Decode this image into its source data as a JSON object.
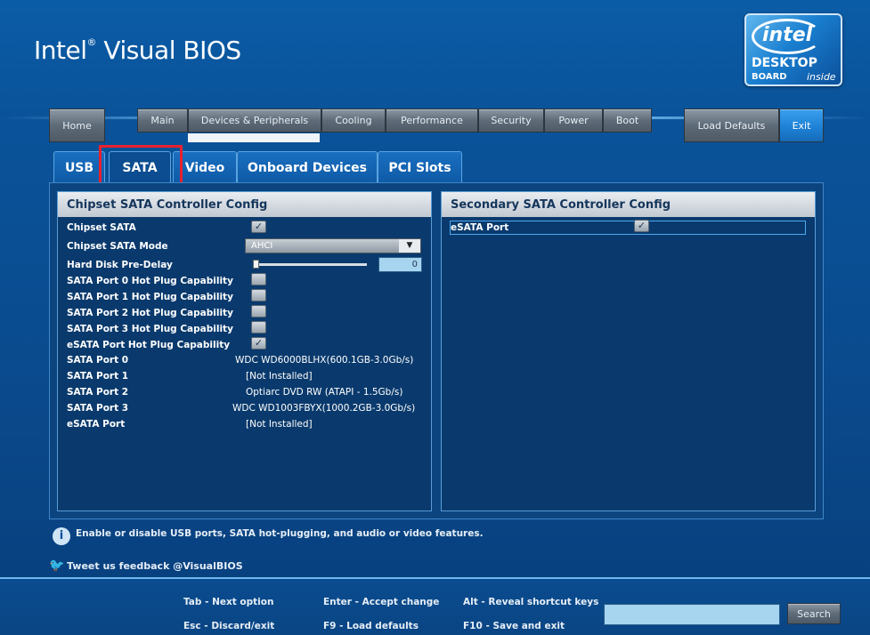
{
  "app": {
    "title": "Intel",
    "title_mark": "®",
    "title_rest": " Visual BIOS"
  },
  "logo": {
    "brand": "intel",
    "line1": "DESKTOP",
    "line2": "BOARD",
    "line3": "inside"
  },
  "nav": {
    "home": "Home",
    "menu": [
      "Main",
      "Devices & Peripherals",
      "Cooling",
      "Performance",
      "Security",
      "Power",
      "Boot"
    ],
    "active_menu": "Devices & Peripherals",
    "load_defaults": "Load Defaults",
    "exit": "Exit"
  },
  "subtabs": [
    "USB",
    "SATA",
    "Video",
    "Onboard Devices",
    "PCI Slots"
  ],
  "active_subtab": "SATA",
  "chipset_panel": {
    "title": "Chipset SATA Controller Config",
    "rows": [
      {
        "label": "Chipset SATA",
        "checked": true
      },
      {
        "label": "Chipset SATA Mode",
        "value": "AHCI"
      },
      {
        "label": "Hard Disk Pre-Delay",
        "value": "0"
      },
      {
        "label": "SATA Port 0 Hot Plug Capability",
        "checked": false
      },
      {
        "label": "SATA Port 1 Hot Plug Capability",
        "checked": false
      },
      {
        "label": "SATA Port 2 Hot Plug Capability",
        "checked": false
      },
      {
        "label": "SATA Port 3 Hot Plug Capability",
        "checked": false
      },
      {
        "label": "eSATA Port Hot Plug Capability",
        "checked": true
      },
      {
        "label": "SATA Port 0",
        "value": "WDC WD6000BLHX(600.1GB-3.0Gb/s)"
      },
      {
        "label": "SATA Port 1",
        "value": "[Not Installed]"
      },
      {
        "label": "SATA Port 2",
        "value": "Optiarc DVD RW (ATAPI - 1.5Gb/s)"
      },
      {
        "label": "SATA Port 3",
        "value": "WDC WD1003FBYX(1000.2GB-3.0Gb/s)"
      },
      {
        "label": "eSATA Port",
        "value": "[Not Installed]"
      }
    ]
  },
  "secondary_panel": {
    "title": "Secondary SATA Controller Config",
    "rows": [
      {
        "label": "eSATA Port",
        "checked": true
      }
    ]
  },
  "info": {
    "text": "Enable or disable USB ports, SATA hot-plugging, and audio or video features."
  },
  "twitter": {
    "text": "Tweet us feedback @VisualBIOS"
  },
  "footer": {
    "hints": [
      "Tab - Next option",
      "Esc - Discard/exit",
      "Enter - Accept change",
      "F9 - Load defaults",
      "Alt - Reveal shortcut keys",
      "F10 - Save and exit"
    ],
    "search_placeholder": "",
    "search_button": "Search"
  },
  "colors": {
    "accent": "#1d7fd4",
    "highlight": "#e8212e",
    "panel_bg": "#0a3a6d"
  }
}
